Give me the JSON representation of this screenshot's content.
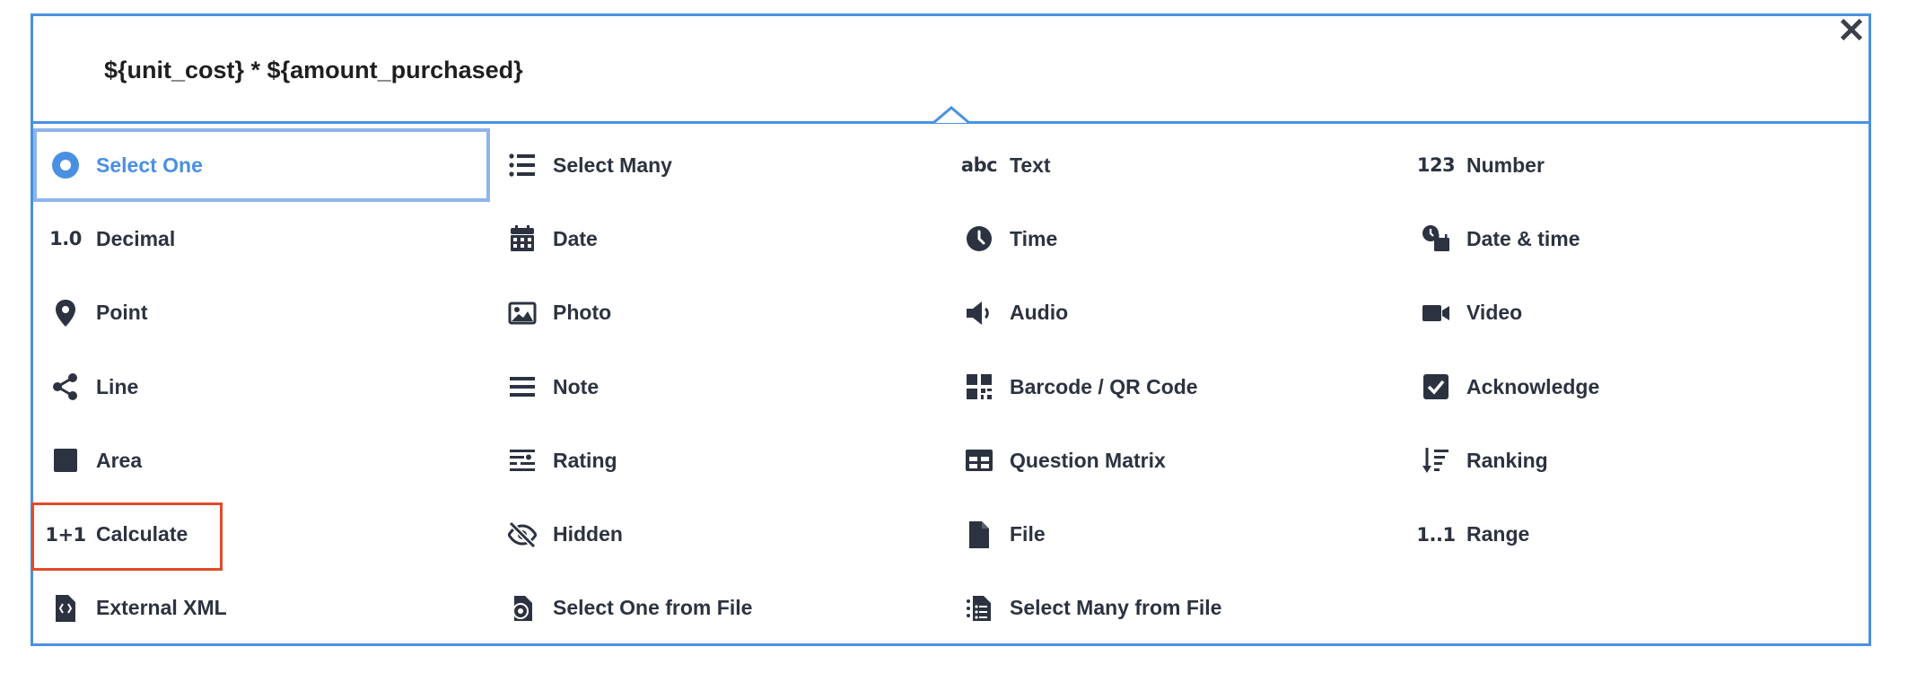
{
  "expression": "${unit_cost} * ${amount_purchased}",
  "colors": {
    "accent": "#4a90e2",
    "text": "#2c3240",
    "highlight": "#e14a2c"
  },
  "types": [
    {
      "label": "Select One",
      "icon": "radio-icon"
    },
    {
      "label": "Select Many",
      "icon": "list-icon"
    },
    {
      "label": "Text",
      "icon": "text-icon",
      "glyph": "abc"
    },
    {
      "label": "Number",
      "icon": "number-icon",
      "glyph": "123"
    },
    {
      "label": "Decimal",
      "icon": "decimal-icon",
      "glyph": "1.0"
    },
    {
      "label": "Date",
      "icon": "calendar-icon"
    },
    {
      "label": "Time",
      "icon": "clock-icon"
    },
    {
      "label": "Date & time",
      "icon": "datetime-icon"
    },
    {
      "label": "Point",
      "icon": "map-pin-icon"
    },
    {
      "label": "Photo",
      "icon": "image-icon"
    },
    {
      "label": "Audio",
      "icon": "speaker-icon"
    },
    {
      "label": "Video",
      "icon": "video-camera-icon"
    },
    {
      "label": "Line",
      "icon": "share-icon"
    },
    {
      "label": "Note",
      "icon": "lines-icon"
    },
    {
      "label": "Barcode / QR Code",
      "icon": "qr-code-icon"
    },
    {
      "label": "Acknowledge",
      "icon": "checkbox-icon"
    },
    {
      "label": "Area",
      "icon": "square-icon"
    },
    {
      "label": "Rating",
      "icon": "rating-icon"
    },
    {
      "label": "Question Matrix",
      "icon": "table-icon"
    },
    {
      "label": "Ranking",
      "icon": "sort-icon"
    },
    {
      "label": "Calculate",
      "icon": "calculate-icon",
      "glyph": "1+1"
    },
    {
      "label": "Hidden",
      "icon": "eye-slash-icon"
    },
    {
      "label": "File",
      "icon": "file-icon"
    },
    {
      "label": "Range",
      "icon": "range-icon",
      "glyph": "1..1"
    },
    {
      "label": "External XML",
      "icon": "xml-file-icon"
    },
    {
      "label": "Select One from File",
      "icon": "select-one-file-icon"
    },
    {
      "label": "Select Many from File",
      "icon": "select-many-file-icon"
    }
  ]
}
